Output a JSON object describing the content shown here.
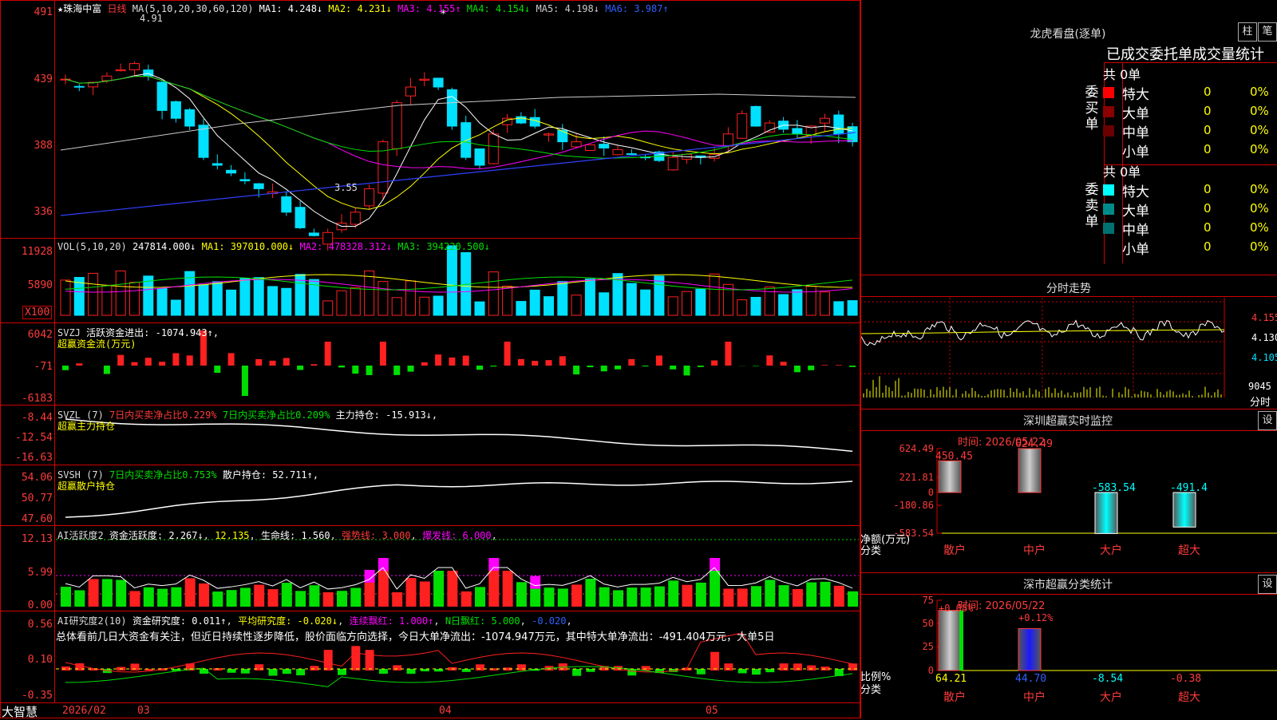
{
  "colors": {
    "up": "#ff2020",
    "down": "#00e0ff",
    "grid": "#d00000",
    "green": "#00e000",
    "magenta": "#ff00ff",
    "yellow": "#ffff00"
  },
  "kline": {
    "title": "★珠海中富",
    "period": "日线",
    "ma_label": "MA(5,10,20,30,60,120)",
    "ma_values": [
      {
        "label": "MA1: 4.248↓",
        "color": "#ffffff"
      },
      {
        "label": "MA2: 4.231↓",
        "color": "#ffff00"
      },
      {
        "label": "MA3: 4.155↑",
        "color": "#ff00ff"
      },
      {
        "label": "MA4: 4.154↓",
        "color": "#00e000"
      },
      {
        "label": "MA5: 4.198↓",
        "color": "#cccccc"
      },
      {
        "label": "MA6: 3.987↑",
        "color": "#3060ff"
      }
    ],
    "y_ticks": [
      "491",
      "439",
      "388",
      "336"
    ],
    "high_label": "4.91",
    "low_label": "3.55"
  },
  "vol": {
    "title": "VOL(5,10,20)",
    "value": "247814.000↓",
    "ma": [
      {
        "label": "MA1: 397010.000↓",
        "color": "#ffff00"
      },
      {
        "label": "MA2: 478328.312↓",
        "color": "#ff00ff"
      },
      {
        "label": "MA3: 394220.500↓",
        "color": "#00e000"
      }
    ],
    "y_ticks": [
      "11928",
      "5890"
    ],
    "unit": "X100"
  },
  "svzj": {
    "title": "SVZJ",
    "label": "活跃资金进出: -1074.943↑,",
    "sub": "超赢资金流(万元)",
    "y_ticks": [
      "6042",
      "-71",
      "-6183"
    ]
  },
  "svzl": {
    "title": "SVZL (7)",
    "a": "7日内买卖净占比0.229%",
    "b": "7日内买卖净占比0.209%",
    "c": "主力持仓: -15.913↓,",
    "sub": "超赢主力持仓",
    "y_ticks": [
      "-8.44",
      "-12.54",
      "-16.63"
    ]
  },
  "svsh": {
    "title": "SVSH (7)",
    "a": "7日内买卖净占比0.753%",
    "c": "散户持仓: 52.711↑,",
    "sub": "超赢散户持仓",
    "y_ticks": [
      "54.06",
      "50.77",
      "47.60"
    ]
  },
  "ai1": {
    "title": "AI活跃度2",
    "a": "资金活跃度: 2.267↓",
    "b": "12.135",
    "c": "生命线: 1.560",
    "d": "强势线: 3.000",
    "e": "爆发线: 6.000",
    "y_ticks": [
      "12.13",
      "5.99",
      "0.00"
    ]
  },
  "ai2": {
    "title": "AI研究度2(10)",
    "a": "资金研究度: 0.011↑",
    "b": "平均研究度: -0.020↓",
    "c": "连续飘红: 1.000↑",
    "d": "N日飘红: 5.000",
    "e": "-0.020",
    "y_ticks": [
      "0.56",
      "0.10",
      "-0.35"
    ],
    "text": "总体看前几日大资金有关注，但近日持续性逐步降低，股价面临方向选择，今日大单净流出：-1074.947万元，其中特大单净流出：-491.404万元，大单5日"
  },
  "xaxis": {
    "brand": "大智慧",
    "labels": [
      "2026/02",
      "03",
      "04",
      "05"
    ]
  },
  "dragon": {
    "title": "龙虎看盘(逐单)",
    "btn1": "柱",
    "btn2": "笔",
    "subtitle": "已成交委托单成交量统计",
    "buy": {
      "side": "委买单",
      "total": "共 0单",
      "rows": [
        {
          "name": "特大",
          "v": "0",
          "p": "0%",
          "c": "#ff0000"
        },
        {
          "name": "大单",
          "v": "0",
          "p": "0%",
          "c": "#8b0000"
        },
        {
          "name": "中单",
          "v": "0",
          "p": "0%",
          "c": "#6a0000"
        },
        {
          "name": "小单",
          "v": "0",
          "p": "0%",
          "c": ""
        }
      ]
    },
    "sell": {
      "side": "委卖单",
      "total": "共 0单",
      "rows": [
        {
          "name": "特大",
          "v": "0",
          "p": "0%",
          "c": "#00ffff"
        },
        {
          "name": "大单",
          "v": "0",
          "p": "0%",
          "c": "#008b8b"
        },
        {
          "name": "中单",
          "v": "0",
          "p": "0%",
          "c": "#007070"
        },
        {
          "name": "小单",
          "v": "0",
          "p": "0%",
          "c": ""
        }
      ]
    }
  },
  "fenshi": {
    "title": "分时走势",
    "prices": [
      "4.155",
      "4.130",
      "4.105"
    ],
    "vol": "9045",
    "unit": "分时"
  },
  "sz_monitor": {
    "title": "深圳超赢实时监控",
    "btn": "设",
    "time": "时间: 2026/05/22",
    "y_ticks": [
      "624.49",
      "221.81",
      "0",
      "-180.86",
      "-583.54"
    ],
    "ylabel": "净额(万元)",
    "xlabel": "分类",
    "chart_data": {
      "type": "bar",
      "categories": [
        "散户",
        "中户",
        "大户",
        "超大"
      ],
      "values": [
        450.45,
        624.49,
        -583.54,
        -491.4
      ],
      "value_labels": [
        "450.45",
        "624.49",
        "-583.54",
        "-491.4"
      ],
      "ylim": [
        -583.54,
        624.49
      ]
    }
  },
  "sz_class": {
    "title": "深市超赢分类统计",
    "btn": "设",
    "time": "时间: 2026/05/22",
    "y_ticks": [
      "75",
      "50",
      "25",
      "0"
    ],
    "ylabel": "比例%",
    "xlabel": "分类",
    "chart_data": {
      "type": "bar",
      "categories": [
        "散户",
        "中户",
        "大户",
        "超大"
      ],
      "values": [
        64.21,
        44.7,
        -8.54,
        -0.38
      ],
      "value_labels": [
        "64.21",
        "44.70",
        "-8.54",
        "-0.38"
      ],
      "top_labels": [
        "+0.08%",
        "+0.12%"
      ],
      "ylim": [
        0,
        75
      ]
    }
  }
}
